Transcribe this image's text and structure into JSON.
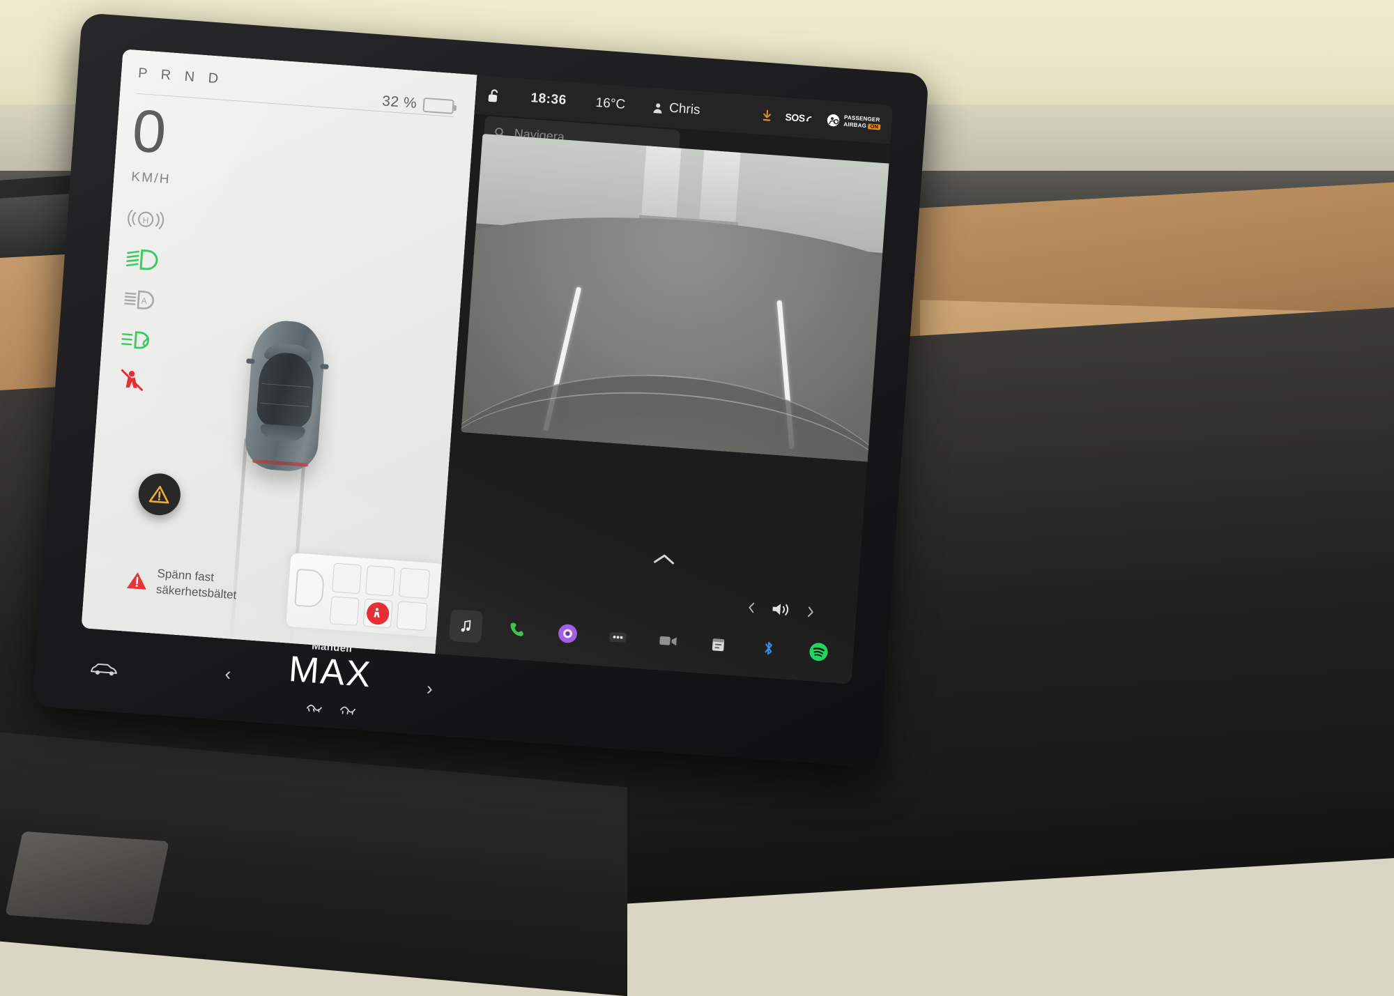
{
  "cluster": {
    "gear_indicator": "P R N D",
    "gear_selected": "P",
    "speed_value": "0",
    "speed_unit": "KM/H",
    "battery_percent": "32 %",
    "battery_level": 32,
    "telltales": [
      {
        "name": "parking-brake",
        "label": "H",
        "color": "#9a9a9a",
        "state": "off"
      },
      {
        "name": "low-beam",
        "label": "low beam",
        "color": "#35c759",
        "state": "on"
      },
      {
        "name": "auto-high-beam",
        "label": "auto high beam",
        "color": "#a5a5a5",
        "state": "off"
      },
      {
        "name": "fog-light",
        "label": "fog",
        "color": "#35c759",
        "state": "on"
      },
      {
        "name": "seatbelt",
        "label": "seatbelt",
        "color": "#e3262b",
        "state": "alert"
      }
    ],
    "alert_icon": "warning-triangle",
    "alert_icon_color": "#f0a92e",
    "warning_line1": "Spänn fast",
    "warning_line2": "säkerhetsbältet",
    "warning_color": "#e3262b"
  },
  "statusbar": {
    "lock_icon": "unlocked-padlock",
    "time": "18:36",
    "temperature": "16°C",
    "profile_icon": "person-icon",
    "profile_name": "Chris",
    "download_icon": "download-arrow",
    "download_color": "#e08a1e",
    "sos_label": "SOS",
    "airbag_line1": "PASSENGER",
    "airbag_line2": "AIRBAG",
    "airbag_state": "ON",
    "airbag_state_color": "#e08a1e"
  },
  "navigation": {
    "search_placeholder": "Navigera",
    "search_icon": "search-icon"
  },
  "camera": {
    "view": "front-camera",
    "expand_icon": "chevron-up-icon"
  },
  "volume": {
    "prev_icon": "chevron-left-icon",
    "speaker_icon": "speaker-icon",
    "next_icon": "chevron-right-icon"
  },
  "dock": {
    "items": [
      {
        "name": "media-player",
        "icon": "music-note-icon",
        "color": "#e9e9e9"
      },
      {
        "name": "phone",
        "icon": "phone-icon",
        "color": "#37c14a"
      },
      {
        "name": "camera-app",
        "icon": "camera-lens-icon",
        "color": "#a05ae0"
      },
      {
        "name": "apps-grid",
        "icon": "dots-grid-icon",
        "color": "#e9e9e9"
      },
      {
        "name": "dashcam",
        "icon": "dashcam-icon",
        "color": "#9a9a9a"
      },
      {
        "name": "calendar",
        "icon": "calendar-icon",
        "color": "#d8d8d8"
      },
      {
        "name": "bluetooth",
        "icon": "bluetooth-icon",
        "color": "#2e8fe8"
      },
      {
        "name": "spotify",
        "icon": "spotify-icon",
        "color": "#1ed760"
      }
    ]
  },
  "climate": {
    "mode_label": "Manuell",
    "fan_label": "MAX",
    "prev_icon": "chevron-left-icon",
    "next_icon": "chevron-right-icon",
    "car_controls_icon": "car-side-icon",
    "defrost_front_icon": "front-defrost-icon",
    "defrost_rear_icon": "rear-defrost-icon"
  }
}
